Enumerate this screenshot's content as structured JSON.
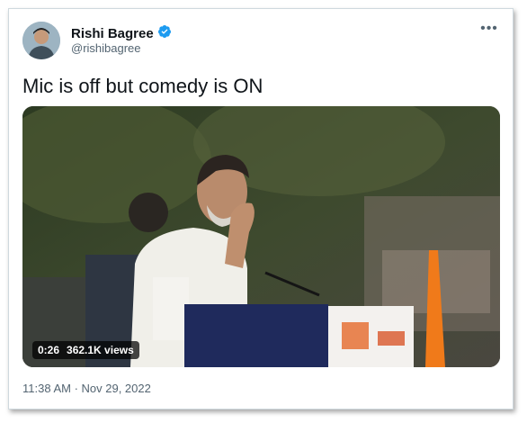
{
  "author": {
    "display_name": "Rishi Bagree",
    "handle": "@rishibagree"
  },
  "tweet": {
    "text": "Mic is off but comedy is ON",
    "timestamp": "11:38 AM · Nov 29, 2022"
  },
  "video": {
    "duration": "0:26",
    "views": "362.1K views"
  },
  "icons": {
    "more": "more-dots-icon",
    "verified": "verified-badge-icon"
  },
  "colors": {
    "verified_blue": "#1d9bf0",
    "text_primary": "#0f1419",
    "text_secondary": "#536471",
    "border": "#cfd9de"
  }
}
